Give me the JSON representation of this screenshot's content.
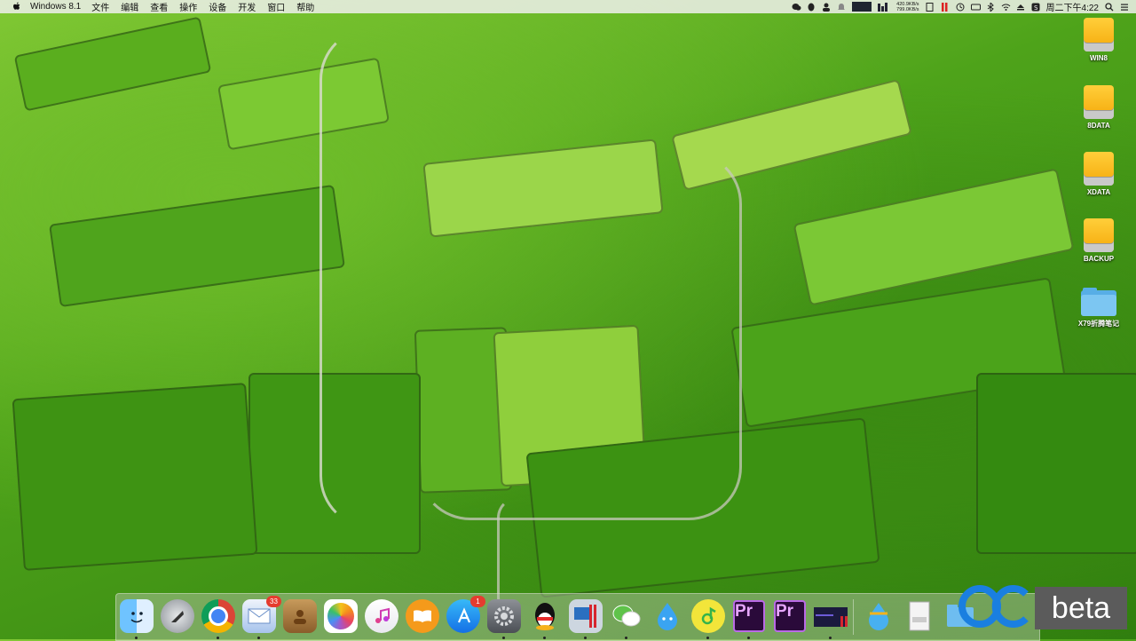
{
  "menubar": {
    "app_name": "Windows 8.1",
    "menus": [
      "文件",
      "编辑",
      "查看",
      "操作",
      "设备",
      "开发",
      "窗口",
      "帮助"
    ],
    "net_up": "420.9KB/s",
    "net_down": "799.0KB/s",
    "clock": "周二下午4:22"
  },
  "desktop": {
    "icons": [
      {
        "label": "WIN8",
        "type": "drive"
      },
      {
        "label": "8DATA",
        "type": "drive"
      },
      {
        "label": "XDATA",
        "type": "drive"
      },
      {
        "label": "BACKUP",
        "type": "drive"
      },
      {
        "label": "X79折腾笔记",
        "type": "folder"
      }
    ]
  },
  "dock": {
    "items": [
      {
        "name": "finder"
      },
      {
        "name": "launchpad"
      },
      {
        "name": "chrome"
      },
      {
        "name": "mail",
        "badge": "33"
      },
      {
        "name": "contacts"
      },
      {
        "name": "photos"
      },
      {
        "name": "itunes"
      },
      {
        "name": "ibooks"
      },
      {
        "name": "app-store",
        "badge": "1"
      },
      {
        "name": "system-preferences"
      },
      {
        "name": "qq"
      },
      {
        "name": "parallels-windows"
      },
      {
        "name": "wechat"
      },
      {
        "name": "qq-droplet"
      },
      {
        "name": "qq-music"
      },
      {
        "name": "premiere-1",
        "text": "Pr"
      },
      {
        "name": "premiere-2",
        "text": "Pr"
      },
      {
        "name": "screen-app"
      },
      {
        "name": "finder-droplet"
      },
      {
        "name": "document"
      },
      {
        "name": "downloads-folder"
      }
    ],
    "watermark_text": "beta"
  }
}
